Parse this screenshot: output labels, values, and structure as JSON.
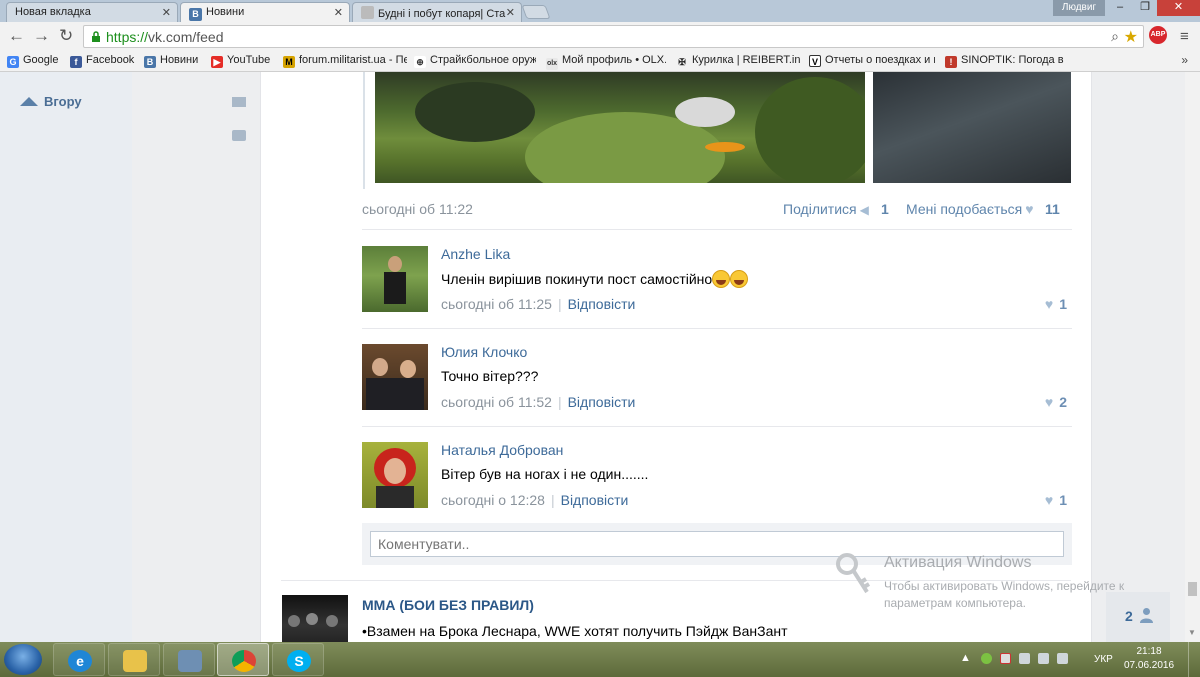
{
  "browser": {
    "tabs": [
      {
        "title": "Новая вкладка",
        "active": false
      },
      {
        "title": "Новини",
        "active": true,
        "favicon": "В"
      },
      {
        "title": "Будні і побут копаря| Ста",
        "active": false
      }
    ],
    "user_name": "Людвиг",
    "window_controls": {
      "minimize": "–",
      "maximize": "❐",
      "close": "✕"
    },
    "url_scheme": "https://",
    "url_rest": "vk.com/feed",
    "bookmarks": [
      {
        "label": "Google",
        "icon": "google-icon",
        "color": "#4285f4"
      },
      {
        "label": "Facebook",
        "icon": "facebook-icon",
        "color": "#3b5998"
      },
      {
        "label": "Новини",
        "icon": "vk-icon",
        "color": "#4a76a8"
      },
      {
        "label": "YouTube",
        "icon": "youtube-icon",
        "color": "#e52d27"
      },
      {
        "label": "forum.militarist.ua - Пе",
        "icon": "militarist-icon",
        "color": "#d6a300"
      },
      {
        "label": "Страйкбольное оруж",
        "icon": "crosshair-icon",
        "color": "#555555"
      },
      {
        "label": "Мой профиль • OLX.ua",
        "icon": "olx-icon",
        "color": "#e8e8e8"
      },
      {
        "label": "Курилка | REIBERT.info",
        "icon": "cross-icon",
        "color": "#333333"
      },
      {
        "label": "Отчеты о поездках и н",
        "icon": "v-icon",
        "color": "#ffffff"
      },
      {
        "label": "SINOPTIK: Погода в Л",
        "icon": "sinoptik-icon",
        "color": "#c0392b"
      }
    ],
    "bookmarks_more": "»"
  },
  "sidebar": {
    "up_label": "Вгору"
  },
  "post": {
    "date": "сьогодні об 11:22",
    "share_label": "Поділитися",
    "share_count": "1",
    "like_label": "Мені подобається",
    "like_count": "11"
  },
  "comments": [
    {
      "author": "Anzhe Lika",
      "text": "Членін вирішив покинути пост самостійно",
      "emoji_count": 2,
      "time": "сьогодні об 11:25",
      "reply": "Відповісти",
      "likes": "1"
    },
    {
      "author": "Юлия Клочко",
      "text": "Точно вітер???",
      "emoji_count": 0,
      "time": "сьогодні об 11:52",
      "reply": "Відповісти",
      "likes": "2"
    },
    {
      "author": "Наталья Доброван",
      "text": "Вітер був на ногах і не один.......",
      "emoji_count": 0,
      "time": "сьогодні о 12:28",
      "reply": "Відповісти",
      "likes": "1"
    }
  ],
  "reply_box": {
    "placeholder": "Коментувати.."
  },
  "next_post": {
    "title": "ММА (БОИ БЕЗ ПРАВИЛ)",
    "text": "•Взамен на Брока Леснара, WWE хотят получить Пэйдж ВанЗант"
  },
  "activation": {
    "title": "Активация Windows",
    "subtitle": "Чтобы активировать Windows, перейдите к параметрам компьютера."
  },
  "online": {
    "count": "2"
  },
  "taskbar": {
    "apps": [
      {
        "name": "internet-explorer",
        "glyph": "e",
        "color": "#1f86d6",
        "open": false
      },
      {
        "name": "file-explorer",
        "glyph": "",
        "color": "#e8c24a",
        "open": false
      },
      {
        "name": "calculator",
        "glyph": "",
        "color": "#6e8fb3",
        "open": false
      },
      {
        "name": "chrome",
        "glyph": "",
        "color": "#db4437",
        "open": true
      },
      {
        "name": "skype",
        "glyph": "S",
        "color": "#00aff0",
        "open": false
      }
    ],
    "language": "УКР",
    "time": "21:18",
    "date": "07.06.2016"
  }
}
